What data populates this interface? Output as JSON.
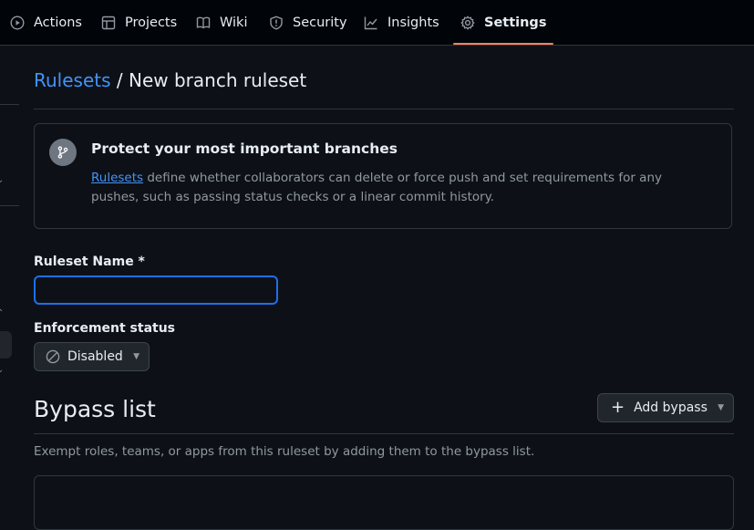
{
  "nav": {
    "tabs": [
      {
        "label": "Actions",
        "icon": "play-icon"
      },
      {
        "label": "Projects",
        "icon": "table-icon"
      },
      {
        "label": "Wiki",
        "icon": "book-icon"
      },
      {
        "label": "Security",
        "icon": "shield-icon"
      },
      {
        "label": "Insights",
        "icon": "graph-icon"
      },
      {
        "label": "Settings",
        "icon": "gear-icon",
        "active": true
      }
    ]
  },
  "breadcrumb": {
    "parent": "Rulesets",
    "separator": "/",
    "current": "New branch ruleset"
  },
  "info": {
    "icon": "git-branch-icon",
    "title": "Protect your most important branches",
    "link_text": "Rulesets",
    "description": "define whether collaborators can delete or force push and set requirements for any pushes, such as passing status checks or a linear commit history."
  },
  "form": {
    "name_label": "Ruleset Name *",
    "name_value": "",
    "enforcement_label": "Enforcement status",
    "enforcement_value": "Disabled"
  },
  "bypass": {
    "title": "Bypass list",
    "add_button": "Add bypass",
    "description": "Exempt roles, teams, or apps from this ruleset by adding them to the bypass list."
  },
  "colors": {
    "background": "#0d1117",
    "accent": "#4493f8",
    "active_tab_underline": "#f78166"
  }
}
